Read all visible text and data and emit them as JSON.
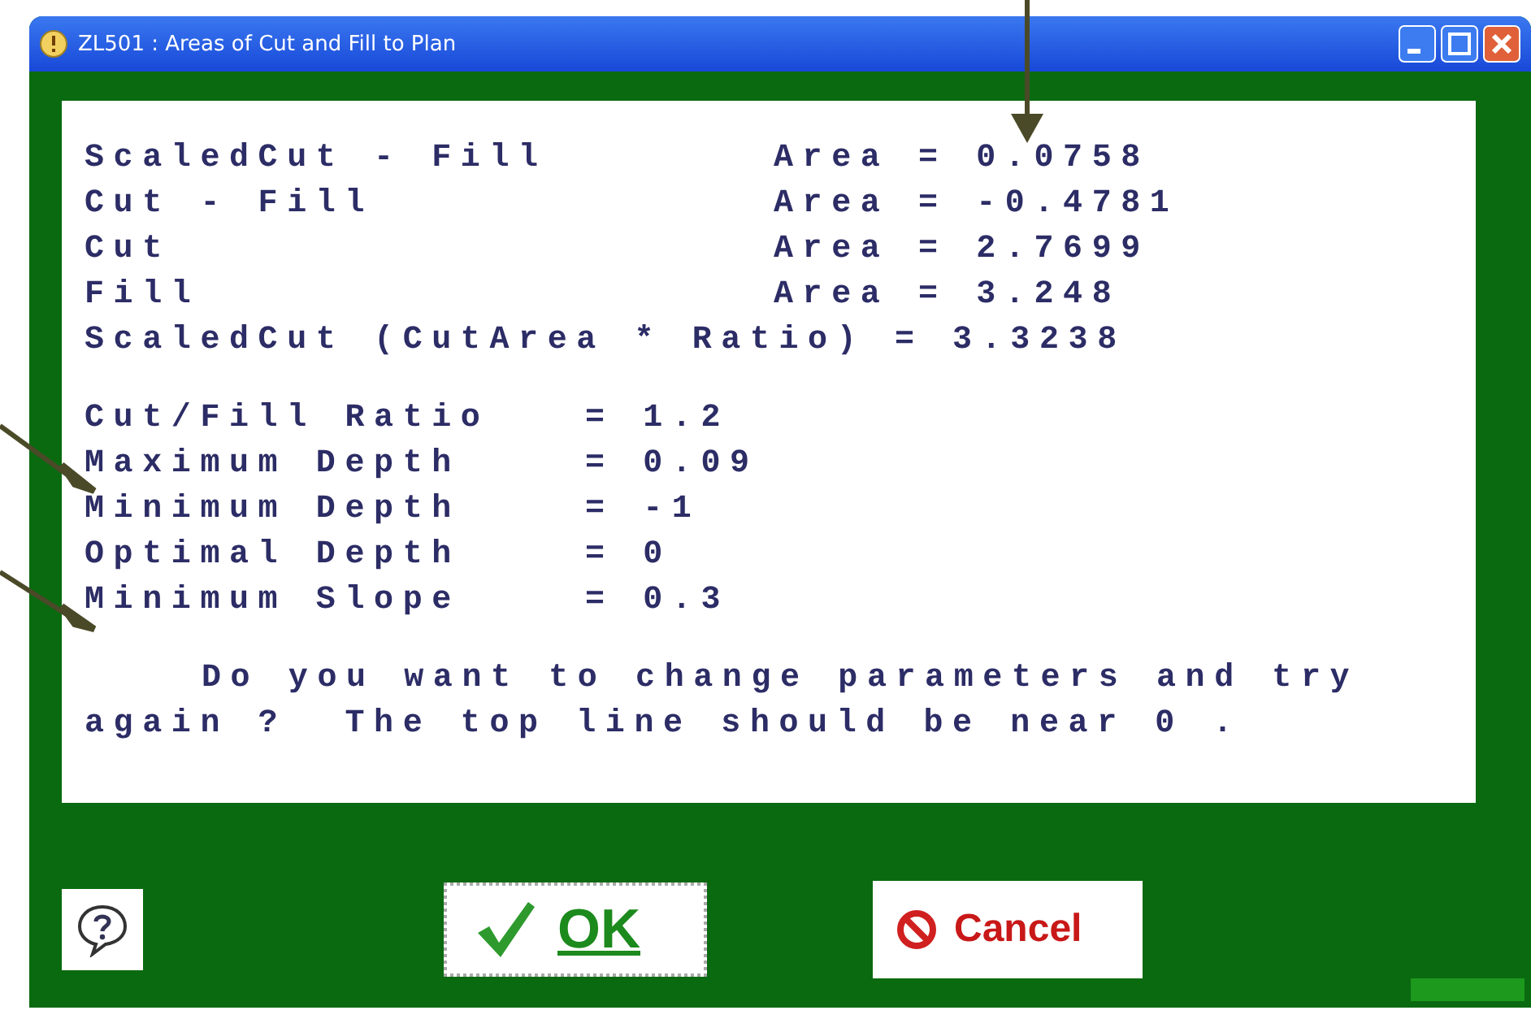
{
  "window": {
    "title": "ZL501 : Areas of Cut and Fill to Plan"
  },
  "areas": [
    {
      "label": "ScaledCut - Fill",
      "value": "Area = 0.0758"
    },
    {
      "label": "Cut - Fill",
      "value": "Area = -0.4781"
    },
    {
      "label": "Cut",
      "value": "Area = 2.7699"
    },
    {
      "label": "Fill",
      "value": "Area = 3.248"
    },
    {
      "label": "ScaledCut (CutArea * Ratio) = 3.3238"
    }
  ],
  "parameters": [
    {
      "label": "Cut/Fill Ratio",
      "value": "= 1.2"
    },
    {
      "label": "Maximum Depth",
      "value": "= 0.09"
    },
    {
      "label": "Minimum Depth",
      "value": "= -1"
    },
    {
      "label": "Optimal Depth",
      "value": "= 0"
    },
    {
      "label": "Minimum Slope",
      "value": "= 0.3"
    }
  ],
  "message": "Do you want to change parameters and try again ?  The top line should be near 0 .",
  "buttons": [
    {
      "kind": "help"
    },
    {
      "kind": "ok",
      "label": "OK"
    },
    {
      "kind": "cancel",
      "label": "Cancel"
    }
  ]
}
